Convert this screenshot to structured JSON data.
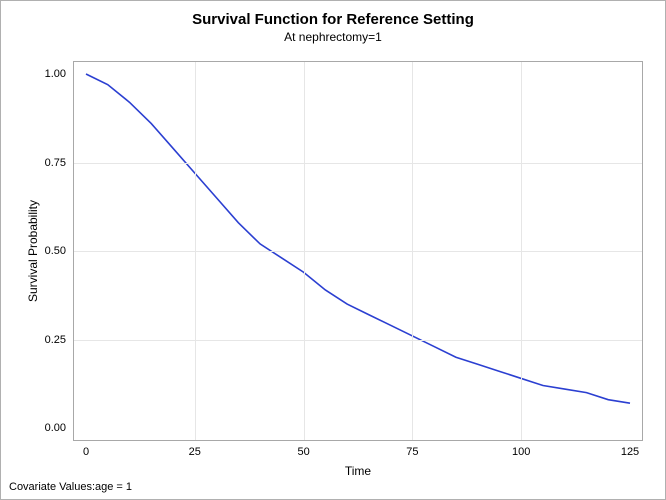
{
  "title": "Survival Function for Reference Setting",
  "subtitle": "At nephrectomy=1",
  "xlabel": "Time",
  "ylabel": "Survival Probability",
  "footer": "Covariate Values:age = 1",
  "chart_data": {
    "type": "line",
    "title": "Survival Function for Reference Setting",
    "subtitle": "At nephrectomy=1",
    "xlabel": "Time",
    "ylabel": "Survival Probability",
    "xlim": [
      0,
      125
    ],
    "ylim": [
      0,
      1
    ],
    "x_ticks": [
      0,
      25,
      50,
      75,
      100,
      125
    ],
    "y_ticks": [
      0.0,
      0.25,
      0.5,
      0.75,
      1.0
    ],
    "y_tick_labels": [
      "0.00",
      "0.25",
      "0.50",
      "0.75",
      "1.00"
    ],
    "series": [
      {
        "name": "Survival",
        "color": "#2b3fd1",
        "x": [
          0,
          5,
          10,
          15,
          20,
          25,
          30,
          35,
          40,
          45,
          50,
          55,
          60,
          65,
          70,
          75,
          80,
          85,
          90,
          95,
          100,
          105,
          110,
          115,
          120,
          125
        ],
        "y": [
          1.0,
          0.97,
          0.92,
          0.86,
          0.79,
          0.72,
          0.65,
          0.58,
          0.52,
          0.48,
          0.44,
          0.39,
          0.35,
          0.32,
          0.29,
          0.26,
          0.23,
          0.2,
          0.18,
          0.16,
          0.14,
          0.12,
          0.11,
          0.1,
          0.08,
          0.07
        ]
      }
    ]
  }
}
